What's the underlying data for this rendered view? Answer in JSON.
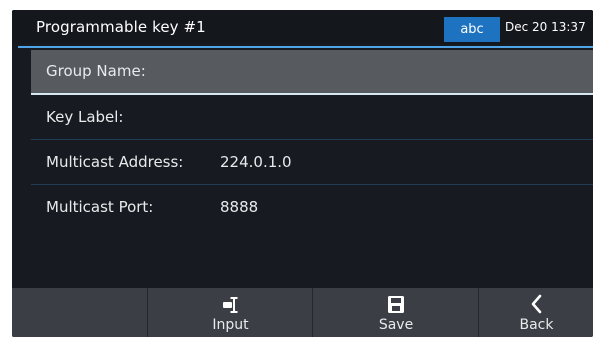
{
  "titlebar": {
    "title": "Programmable key #1",
    "input_mode": "abc",
    "datetime": "Dec 20 13:37"
  },
  "fields": [
    {
      "label": "Group Name:",
      "value": ""
    },
    {
      "label": "Key Label:",
      "value": ""
    },
    {
      "label": "Multicast Address:",
      "value": "224.0.1.0"
    },
    {
      "label": "Multicast Port:",
      "value": "8888"
    }
  ],
  "softkeys": [
    {
      "label": "",
      "icon": ""
    },
    {
      "label": "Input",
      "icon": "input-cursor-icon"
    },
    {
      "label": "Save",
      "icon": "save-icon"
    },
    {
      "label": "Back",
      "icon": "chevron-left-icon"
    }
  ],
  "colors": {
    "screen_bg": "#171a20",
    "accent": "#4ea4e6",
    "badge": "#1e73c1",
    "selected_row": "#575a5f",
    "softkey_bar": "#3b3e44"
  }
}
